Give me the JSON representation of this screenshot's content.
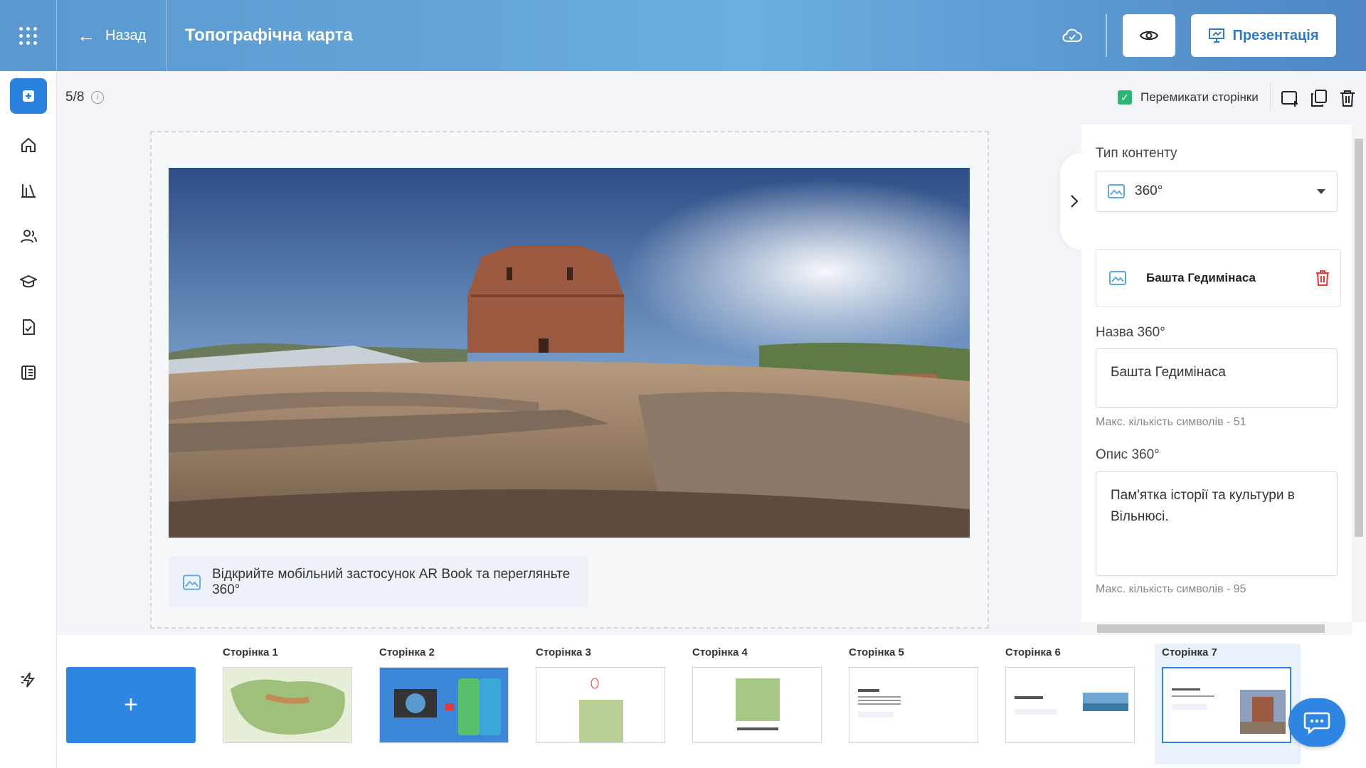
{
  "header": {
    "back_label": "Назад",
    "title": "Топографічна карта",
    "present_label": "Презентація"
  },
  "toolbar": {
    "page_counter": "5/8",
    "switch_pages_label": "Перемикати сторінки",
    "switch_pages_checked": true
  },
  "slide": {
    "caption": "Відкрийте мобільний застосунок AR Book та перегляньте 360°"
  },
  "panel": {
    "content_type_label": "Тип контенту",
    "content_type_value": "360°",
    "item_title": "Башта Гедимінаса",
    "name_label": "Назва 360°",
    "name_value": "Башта Гедимінаса",
    "name_hint": "Макс. кількість символів - 51",
    "desc_label": "Опис 360°",
    "desc_value": "Пам'ятка історії та культури в Вільнюсі.",
    "desc_hint": "Макс. кількість символів - 95"
  },
  "pages": [
    {
      "label": "Сторінка 1"
    },
    {
      "label": "Сторінка 2"
    },
    {
      "label": "Сторінка 3"
    },
    {
      "label": "Сторінка 4"
    },
    {
      "label": "Сторінка 5"
    },
    {
      "label": "Сторінка 6"
    },
    {
      "label": "Сторінка 7"
    }
  ],
  "add_page_label": "+",
  "colors": {
    "accent": "#2f86e2",
    "check": "#2bb673",
    "danger": "#e53935"
  },
  "icons": [
    "apps-grid-icon",
    "arrow-left-icon",
    "cloud-sync-icon",
    "eye-icon",
    "presentation-icon",
    "plus-icon",
    "home-icon",
    "library-icon",
    "users-icon",
    "graduation-cap-icon",
    "document-check-icon",
    "book-icon",
    "flash-icon",
    "info-icon",
    "add-page-icon",
    "copy-icon",
    "trash-icon",
    "chevron-right-icon",
    "image-360-icon",
    "chat-icon"
  ]
}
